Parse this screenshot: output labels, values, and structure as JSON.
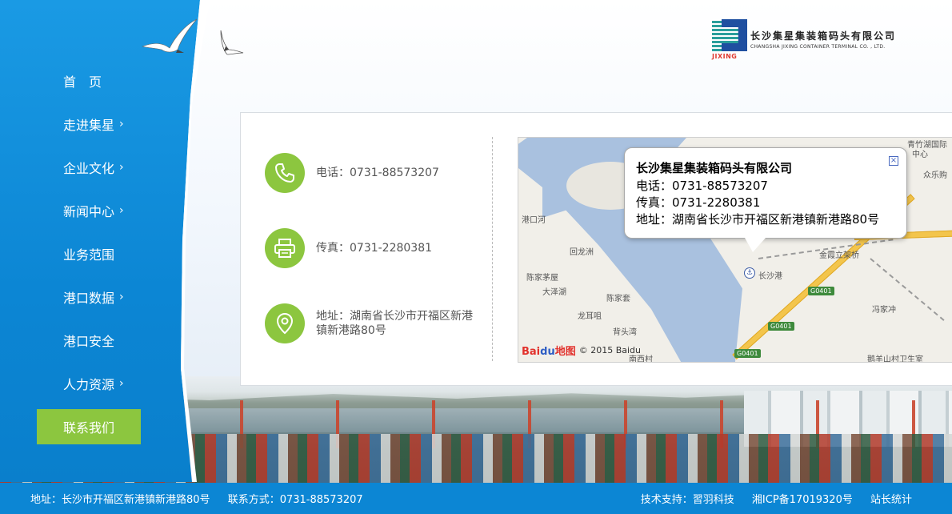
{
  "brand": {
    "name_cn": "长沙集星集装箱码头有限公司",
    "name_en": "CHANGSHA JIXING CONTAINER TERMINAL CO. , LTD.",
    "logo_text": "JIXING"
  },
  "nav": {
    "items": [
      {
        "label": "首　页",
        "has_arrow": false,
        "active": false
      },
      {
        "label": "走进集星",
        "has_arrow": true,
        "active": false
      },
      {
        "label": "企业文化",
        "has_arrow": true,
        "active": false
      },
      {
        "label": "新闻中心",
        "has_arrow": true,
        "active": false
      },
      {
        "label": "业务范围",
        "has_arrow": false,
        "active": false
      },
      {
        "label": "港口数据",
        "has_arrow": true,
        "active": false
      },
      {
        "label": "港口安全",
        "has_arrow": false,
        "active": false
      },
      {
        "label": "人力资源",
        "has_arrow": true,
        "active": false
      },
      {
        "label": "联系我们",
        "has_arrow": false,
        "active": true
      }
    ],
    "arrow_glyph": "›"
  },
  "contact": {
    "phone": "电话：0731-88573207",
    "fax": "传真：0731-2280381",
    "address": "地址：湖南省长沙市开福区新港镇新港路80号"
  },
  "map": {
    "popup": {
      "title": "长沙集星集装箱码头有限公司",
      "phone": "电话：0731-88573207",
      "fax": "传真：0731-2280381",
      "address": "地址：湖南省长沙市开福区新港镇新港路80号"
    },
    "labels": {
      "qingzhuhu": "青竹湖国际",
      "center": "中心",
      "zhongle": "众乐购",
      "gangkouhe": "港口河",
      "huilongzhou": "回龙洲",
      "chenjiamaowu": "陈家茅屋",
      "dazehu": "大泽湖",
      "chenjiatao": "陈家套",
      "longerzhou": "龙耳咀",
      "beichangwan": "背头湾",
      "nanxicun": "南西村",
      "jinxia": "金霞立架桥",
      "changshagang": "长沙港",
      "fengjiachong": "冯家冲",
      "eyangshan": "鹅羊山村卫生室",
      "hw1": "G0401",
      "hw2": "G0401",
      "hw3": "G0401"
    },
    "baidu_logo_a": "Bai",
    "baidu_logo_b": "du",
    "baidu_logo_c": "地图",
    "copyright": "© 2015 Baidu",
    "close_glyph": "×"
  },
  "footer": {
    "address": "地址：长沙市开福区新港镇新港路80号",
    "contact": "联系方式：0731-88573207",
    "tech": "技术支持：習羽科技",
    "icp": "湘ICP备17019320号",
    "stats": "站长统计"
  },
  "colors": {
    "sidebar_blue": "#0c86d4",
    "accent_green": "#8cc63f",
    "footer_blue": "#0c86d4"
  },
  "icons": {
    "phone": "phone-icon",
    "fax": "printer-icon",
    "address": "location-pin-icon"
  }
}
